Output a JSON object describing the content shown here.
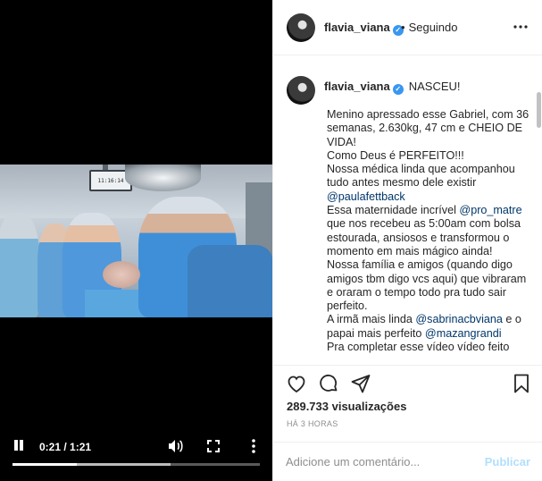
{
  "video": {
    "clock_text": "11:16:14",
    "time_display": "0:21 / 1:21",
    "played_fraction": 0.26,
    "buffered_fraction": 0.64,
    "icons": {
      "pause": "pause-icon",
      "volume": "volume-icon",
      "fullscreen": "fullscreen-icon",
      "more": "more-options-icon"
    }
  },
  "header": {
    "username": "flavia_viana",
    "verified_mark": "✓",
    "dot": "•",
    "follow_status": "Seguindo"
  },
  "caption": {
    "username": "flavia_viana",
    "first_line": "NASCEU!",
    "segments": [
      {
        "t": "Menino apressado esse Gabriel, com 36 semanas, 2.630kg, 47 cm e CHEIO DE VIDA!\nComo Deus é PERFEITO!!!\nNossa médica linda que acompanhou tudo antes mesmo dele existir\n"
      },
      {
        "t": "@paulafettback",
        "mention": true
      },
      {
        "t": "\nEssa maternidade incrível "
      },
      {
        "t": "@pro_matre",
        "mention": true
      },
      {
        "t": " que nos recebeu as 5:00am com bolsa estourada, ansiosos e transformou o momento em mais mágico ainda!\nNossa família e amigos (quando digo amigos tbm digo vcs aqui) que vibraram e oraram o tempo todo pra tudo sair perfeito.\nA irmã mais linda "
      },
      {
        "t": "@sabrinacbviana",
        "mention": true
      },
      {
        "t": " e o papai mais perfeito "
      },
      {
        "t": "@mazangrandi",
        "mention": true
      },
      {
        "t": "\nPra completar esse vídeo vídeo feito"
      }
    ]
  },
  "actions": {
    "icons": [
      "heart-icon",
      "comment-icon",
      "share-icon",
      "bookmark-icon"
    ],
    "views": "289.733 visualizações",
    "timestamp": "HÁ 3 HORAS"
  },
  "comment": {
    "placeholder": "Adicione um comentário...",
    "publish_label": "Publicar"
  },
  "colors": {
    "mention": "#00376b",
    "verified": "#3897f0",
    "publish_disabled": "#b2dffc",
    "muted_text": "#8e8e8e"
  }
}
